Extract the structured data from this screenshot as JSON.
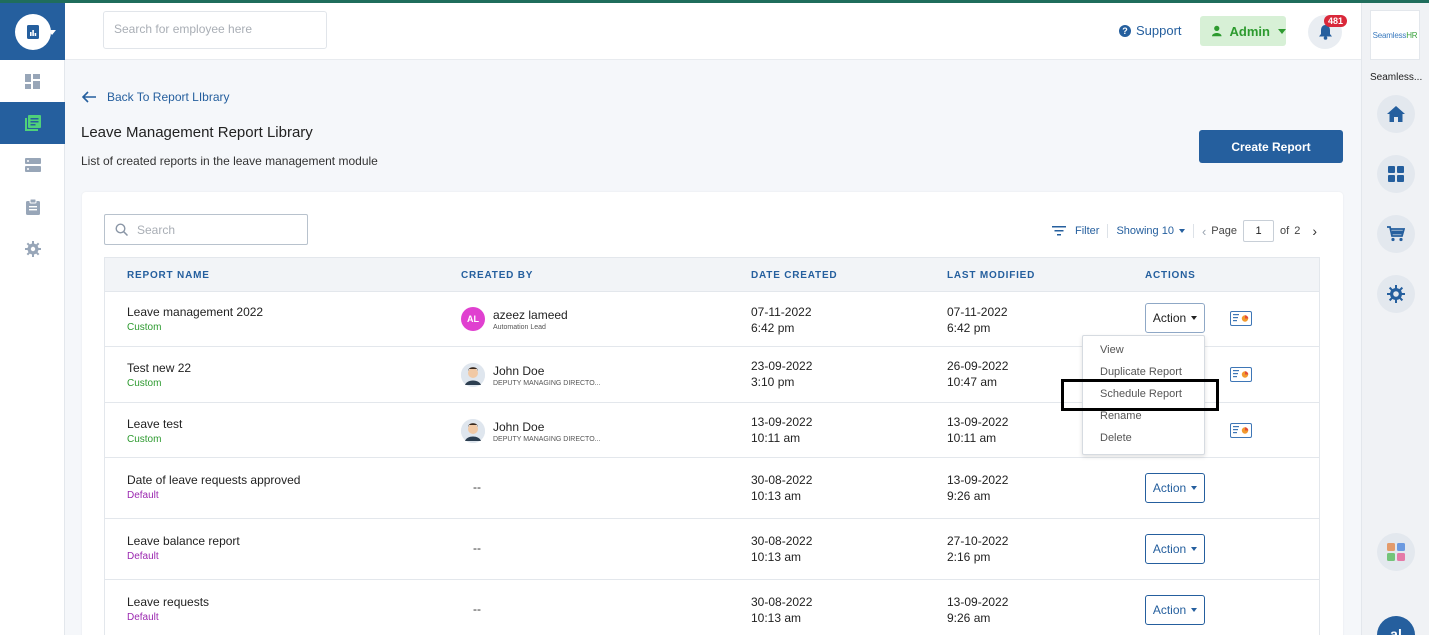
{
  "header": {
    "search_placeholder": "Search for employee here",
    "support_label": "Support",
    "admin_label": "Admin",
    "notif_count": "481"
  },
  "brand": {
    "logo_a": "Seamless",
    "logo_b": "HR",
    "name": "Seamless..."
  },
  "main": {
    "back_label": "Back To Report LIbrary",
    "title": "Leave Management Report Library",
    "subtitle": "List of created reports in the leave management module",
    "create_label": "Create Report"
  },
  "table_controls": {
    "search_placeholder": "Search",
    "filter_label": "Filter",
    "showing_label": "Showing 10",
    "page_label": "Page",
    "page_value": "1",
    "of_label": "of",
    "total_pages": "2"
  },
  "table": {
    "headers": [
      "REPORT NAME",
      "CREATED BY",
      "DATE CREATED",
      "LAST MODIFIED",
      "ACTIONS"
    ],
    "rows": [
      {
        "name": "Leave management 2022",
        "type": "Custom",
        "by_initials": "AL",
        "by_name": "azeez lameed",
        "by_role": "Automation Lead",
        "dc_date": "07-11-2022",
        "dc_time": "6:42 pm",
        "lm_date": "07-11-2022",
        "lm_time": "6:42 pm",
        "action": "Action"
      },
      {
        "name": "Test new 22",
        "type": "Custom",
        "by_name": "John Doe",
        "by_role": "DEPUTY MANAGING DIRECTO...",
        "dc_date": "23-09-2022",
        "dc_time": "3:10 pm",
        "lm_date": "26-09-2022",
        "lm_time": "10:47 am",
        "action": "Action"
      },
      {
        "name": "Leave test",
        "type": "Custom",
        "by_name": "John Doe",
        "by_role": "DEPUTY MANAGING DIRECTO...",
        "dc_date": "13-09-2022",
        "dc_time": "10:11 am",
        "lm_date": "13-09-2022",
        "lm_time": "10:11 am",
        "action": "Action"
      },
      {
        "name": "Date of leave requests approved",
        "type": "Default",
        "by_name": "--",
        "dc_date": "30-08-2022",
        "dc_time": "10:13 am",
        "lm_date": "13-09-2022",
        "lm_time": "9:26 am",
        "action": "Action"
      },
      {
        "name": "Leave balance report",
        "type": "Default",
        "by_name": "--",
        "dc_date": "30-08-2022",
        "dc_time": "10:13 am",
        "lm_date": "27-10-2022",
        "lm_time": "2:16 pm",
        "action": "Action"
      },
      {
        "name": "Leave requests",
        "type": "Default",
        "by_name": "--",
        "dc_date": "30-08-2022",
        "dc_time": "10:13 am",
        "lm_date": "13-09-2022",
        "lm_time": "9:26 am",
        "action": "Action"
      }
    ]
  },
  "action_menu": [
    "View",
    "Duplicate Report",
    "Schedule Report",
    "Rename",
    "Delete"
  ],
  "colors": {
    "primary": "#255f9e",
    "custom": "#2d9a2f",
    "default": "#9b28b0",
    "badge": "#d9283a",
    "avatar_al": "#e040d0"
  },
  "rail_avatar_initials": "al"
}
